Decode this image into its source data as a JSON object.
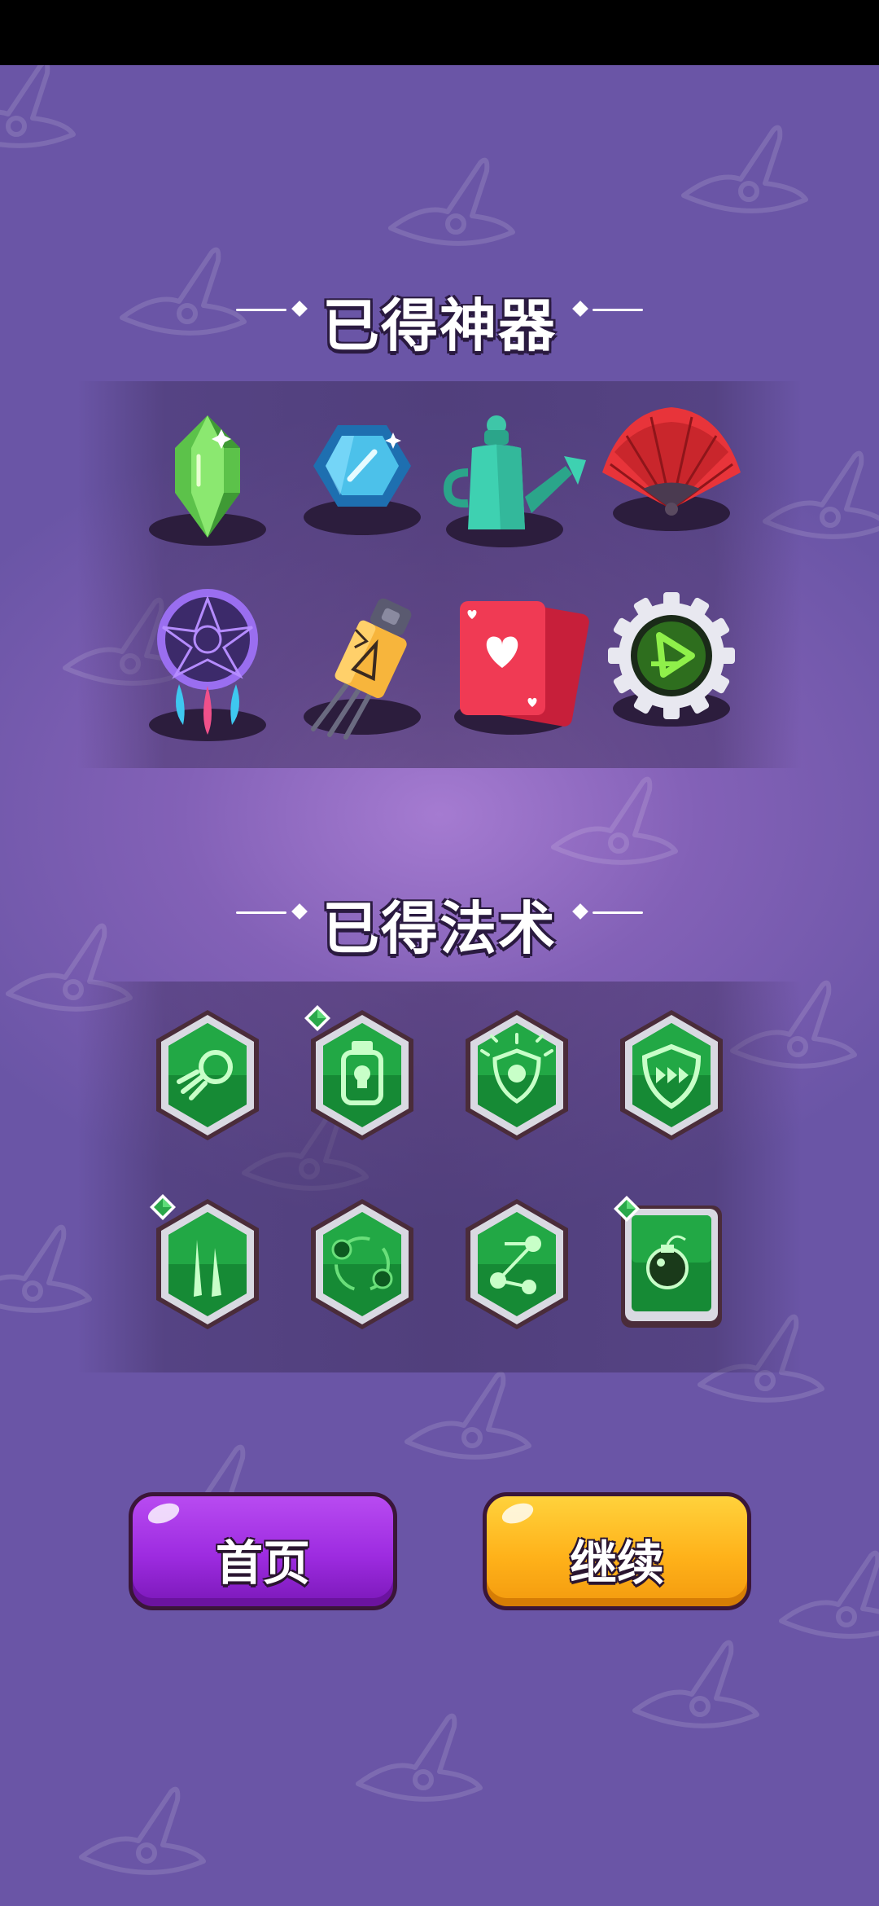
{
  "artifacts_section": {
    "title": "已得神器"
  },
  "artifacts": [
    {
      "icon": "green-crystal-icon"
    },
    {
      "icon": "blue-gem-icon"
    },
    {
      "icon": "watering-can-icon"
    },
    {
      "icon": "red-fan-icon"
    },
    {
      "icon": "dreamcatcher-icon"
    },
    {
      "icon": "battery-plug-icon"
    },
    {
      "icon": "playing-cards-icon"
    },
    {
      "icon": "green-gear-badge-icon"
    }
  ],
  "spells_section": {
    "title": "已得法术"
  },
  "spells": [
    {
      "icon": "fireball-spell-icon",
      "upgraded": false
    },
    {
      "icon": "poison-bottle-spell-icon",
      "upgraded": true
    },
    {
      "icon": "skull-shield-spell-icon",
      "upgraded": false
    },
    {
      "icon": "speed-shield-spell-icon",
      "upgraded": false
    },
    {
      "icon": "spike-spell-icon",
      "upgraded": true
    },
    {
      "icon": "orbit-balls-spell-icon",
      "upgraded": false
    },
    {
      "icon": "chain-skull-spell-icon",
      "upgraded": false
    },
    {
      "icon": "bomb-spell-icon",
      "upgraded": true
    }
  ],
  "buttons": {
    "home": "首页",
    "continue": "继续"
  },
  "colors": {
    "background": "#7a5db2",
    "home_button": "#9d2be0",
    "continue_button": "#ffb21a",
    "spell_green": "#1e9a3e"
  }
}
